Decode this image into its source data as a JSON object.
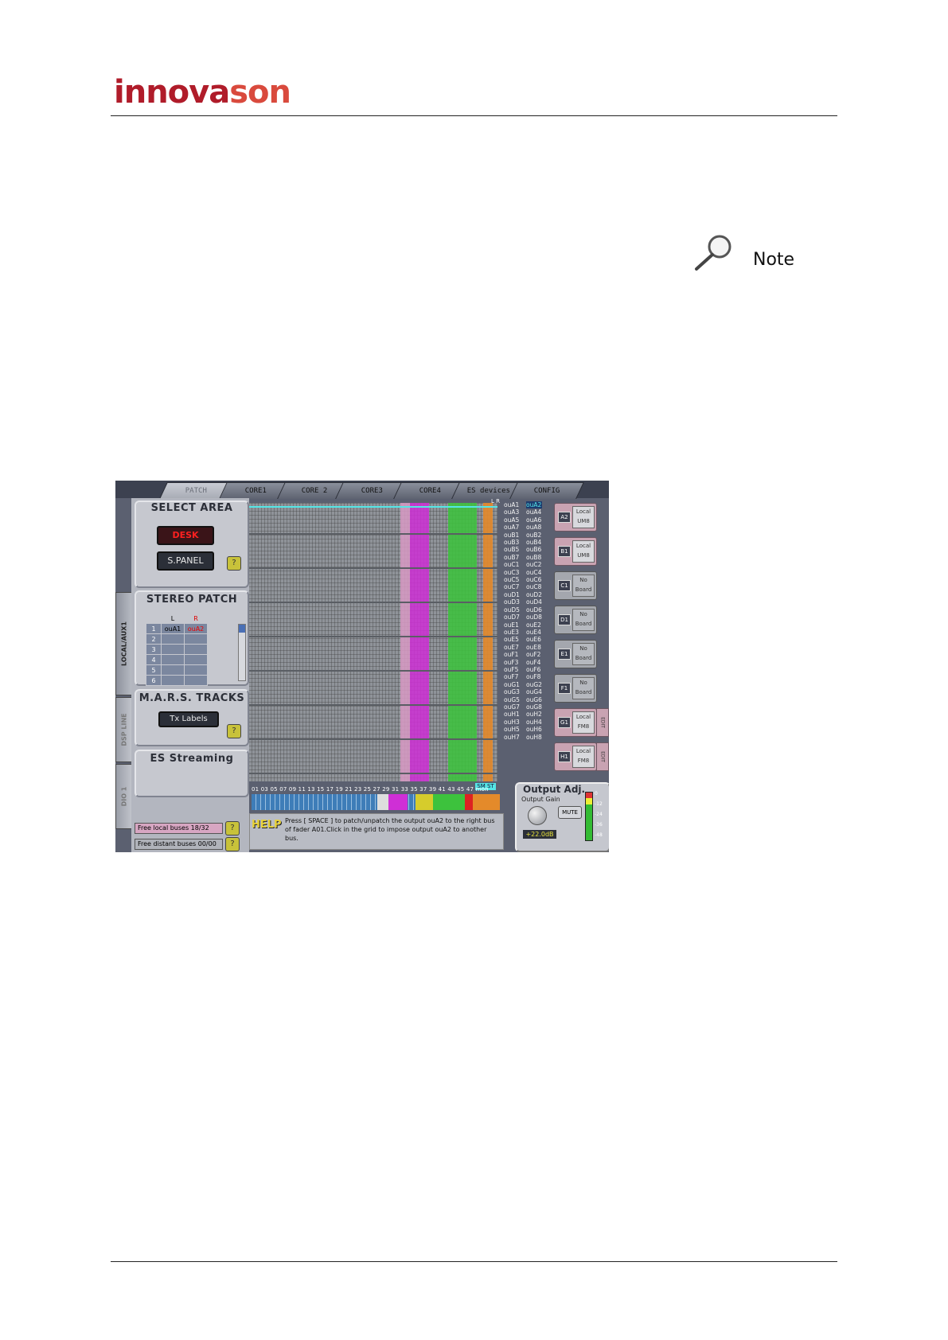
{
  "header": {
    "logo_text_a": "innova",
    "logo_text_b": "son"
  },
  "note": {
    "label": "Note",
    "icon": "magnifier-icon"
  },
  "screenshot": {
    "tabs": [
      "PATCH",
      "CORE1",
      "CORE 2",
      "CORE3",
      "CORE4",
      "ES devices",
      "CONFIG"
    ],
    "active_tab": "PATCH",
    "side_tabs": [
      "LOCAL/AUX1",
      "DSP LINE",
      "DIO 1"
    ],
    "select_area": {
      "title": "SELECT AREA",
      "desk": "DESK",
      "spanel": "S.PANEL",
      "help": "?"
    },
    "stereo_patch": {
      "title": "STEREO PATCH",
      "col_l": "L",
      "col_r": "R",
      "rows": [
        {
          "n": "1",
          "l": "ouA1",
          "r": "ouA2"
        },
        {
          "n": "2",
          "l": "",
          "r": ""
        },
        {
          "n": "3",
          "l": "",
          "r": ""
        },
        {
          "n": "4",
          "l": "",
          "r": ""
        },
        {
          "n": "5",
          "l": "",
          "r": ""
        },
        {
          "n": "6",
          "l": "",
          "r": ""
        }
      ]
    },
    "mars": {
      "title": "M.A.R.S. TRACKS",
      "button": "Tx Labels",
      "help": "?"
    },
    "es_streaming": {
      "title": "ES Streaming"
    },
    "status": {
      "local": "Free local buses 18/32",
      "distant": "Free distant buses 00/00",
      "help": "?"
    },
    "grid_header_lr": "L R",
    "outputs_left": [
      "ouA1",
      "ouA3",
      "ouA5",
      "ouA7",
      "ouB1",
      "ouB3",
      "ouB5",
      "ouB7",
      "ouC1",
      "ouC3",
      "ouC5",
      "ouC7",
      "ouD1",
      "ouD3",
      "ouD5",
      "ouD7",
      "ouE1",
      "ouE3",
      "ouE5",
      "ouE7",
      "ouF1",
      "ouF3",
      "ouF5",
      "ouF7",
      "ouG1",
      "ouG3",
      "ouG5",
      "ouG7",
      "ouH1",
      "ouH3",
      "ouH5",
      "ouH7"
    ],
    "outputs_right": [
      "ouA2",
      "ouA4",
      "ouA6",
      "ouA8",
      "ouB2",
      "ouB4",
      "ouB6",
      "ouB8",
      "ouC2",
      "ouC4",
      "ouC6",
      "ouC8",
      "ouD2",
      "ouD4",
      "ouD6",
      "ouD8",
      "ouE2",
      "ouE4",
      "ouE6",
      "ouE8",
      "ouF2",
      "ouF4",
      "ouF6",
      "ouF8",
      "ouG2",
      "ouG4",
      "ouG6",
      "ouG8",
      "ouH2",
      "ouH4",
      "ouH6",
      "ouH8"
    ],
    "boards": [
      {
        "id": "A2",
        "desc": "Local UM8",
        "edit": false
      },
      {
        "id": "B1",
        "desc": "Local UM8",
        "edit": false
      },
      {
        "id": "C1",
        "desc": "No Board",
        "edit": false
      },
      {
        "id": "D1",
        "desc": "No Board",
        "edit": false
      },
      {
        "id": "E1",
        "desc": "No Board",
        "edit": false
      },
      {
        "id": "F1",
        "desc": "No Board",
        "edit": false
      },
      {
        "id": "G1",
        "desc": "Local FM8",
        "edit": true
      },
      {
        "id": "H1",
        "desc": "Local FM8",
        "edit": true
      }
    ],
    "edit_label": "EDIT",
    "smst_label": "SM ST",
    "fader_numbers": "01 03 05 07 09 11 13 15 17 19 21 23 25 27 29 31 33 35 37 39 41 43 45 47 mon",
    "help": {
      "tag": "HELP",
      "text": "Press [ SPACE ] to patch/unpatch the output ouA2 to the right bus of fader A01.Click in the grid to impose output ouA2 to another bus."
    },
    "output_adj": {
      "title": "Output Adj.",
      "gain_label": "Output Gain",
      "gain_value": "+22.0dB",
      "mute": "MUTE",
      "meter_scale": [
        "0",
        "-12",
        "-24",
        "-36",
        "-48"
      ]
    },
    "colors": {
      "pink": "#d89ac4",
      "magenta": "#cf2fd6",
      "green": "#3dc23d",
      "orange": "#e48a2a",
      "cyan": "#55e6e6"
    }
  }
}
